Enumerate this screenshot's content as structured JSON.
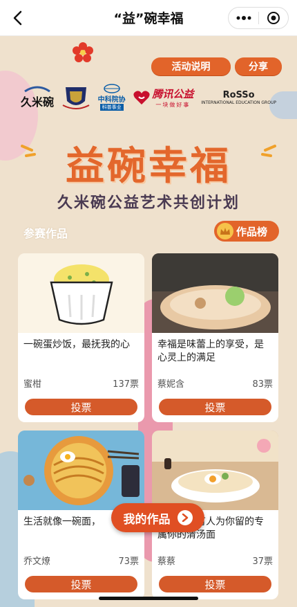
{
  "header": {
    "title": "“益”碗幸福",
    "back_icon": "chevron-left-icon",
    "more_icon": "ellipsis-icon",
    "close_icon": "target-circle-icon"
  },
  "actions": {
    "rules_label": "活动说明",
    "share_label": "分享"
  },
  "logos": {
    "jiumi": "久米碗",
    "cfmsa": "中科院协",
    "cfmsa_sub": "科普事业",
    "tencent": "腾讯公益",
    "tencent_sub": "一块做好事",
    "rosso": "RoSSo",
    "rosso_sub": "INTERNATIONAL EDUCATION GROUP"
  },
  "banner": {
    "headline": "益碗幸福",
    "subheadline": "久米碗公益艺术共创计划"
  },
  "entries_label": "参赛作品",
  "ranking_label": "作品榜",
  "vote_label": "投票",
  "entries": [
    {
      "caption": "一碗蛋炒饭，最抚我的心",
      "author": "蜜柑",
      "votes": "137票"
    },
    {
      "caption": "幸福是味蕾上的享受，是心灵上的满足",
      "author": "蔡妮含",
      "votes": "83票"
    },
    {
      "caption": "生活就像一碗面，",
      "author": "乔文燎",
      "votes": "73票"
    },
    {
      "caption": "下班回家有人为你留的专属你的清汤面",
      "author": "蔡蔡",
      "votes": "37票"
    }
  ],
  "my_works_label": "我的作品",
  "colors": {
    "accent": "#e2642a",
    "background": "#efe1cd",
    "vote_button": "#d55a2a"
  }
}
